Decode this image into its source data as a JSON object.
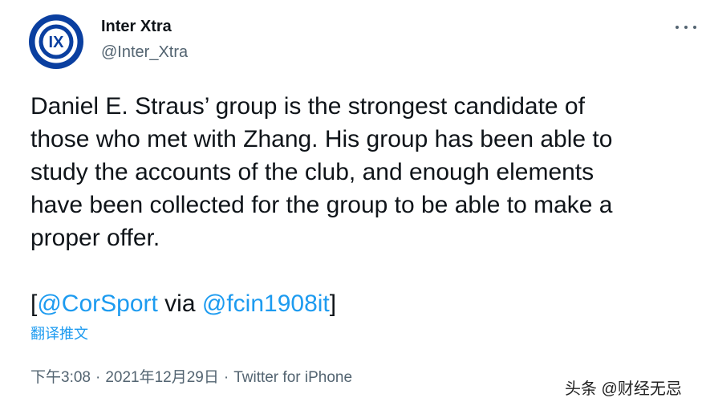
{
  "account": {
    "avatar_text": "IX",
    "display_name": "Inter Xtra",
    "handle": "@Inter_Xtra"
  },
  "menu": {
    "icon": "more-horizontal-icon"
  },
  "tweet": {
    "lines": [
      "Daniel E. Straus’ group is the strongest candidate of",
      "those who met with Zhang. His group has been able to",
      "study the accounts of the club, and enough elements",
      "have been collected for the group to be able to make a",
      "proper offer."
    ],
    "source": {
      "open_bracket": "[",
      "mention_1": "@CorSport",
      "via": " via ",
      "mention_2": "@fcin1908it",
      "close_bracket": "]"
    },
    "translate_label": "翻译推文"
  },
  "meta": {
    "time": "下午3:08",
    "separator": "·",
    "date": "2021年12月29日",
    "client": "Twitter for iPhone"
  },
  "watermark": "头条 @财经无忌",
  "colors": {
    "link": "#1d9bf0",
    "secondary": "#536471",
    "avatar_bg": "#0a3fa0"
  }
}
